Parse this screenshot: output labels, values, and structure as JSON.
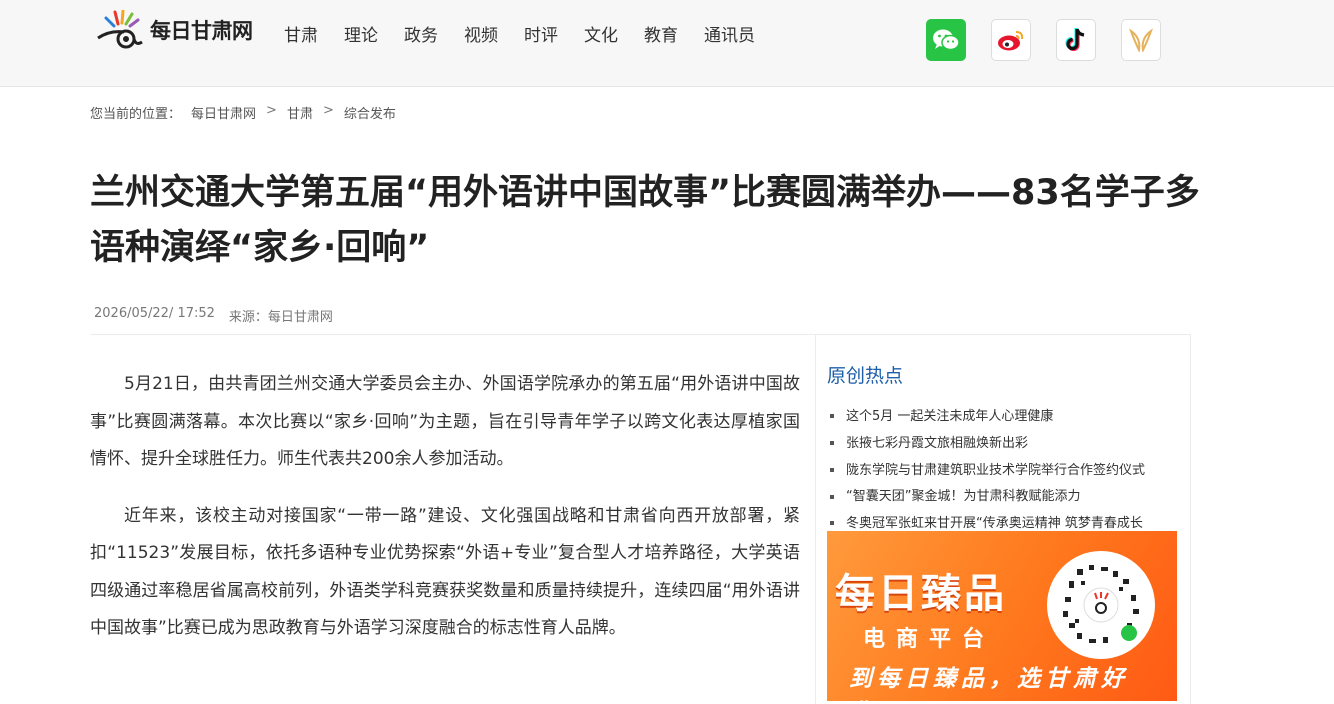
{
  "header": {
    "logo_text": "每日甘肃网",
    "nav": [
      "甘肃",
      "理论",
      "政务",
      "视频",
      "时评",
      "文化",
      "教育",
      "通讯员"
    ],
    "social_icons": [
      "wechat-icon",
      "weibo-icon",
      "tiktok-icon",
      "miniapp-icon"
    ]
  },
  "breadcrumb": {
    "prefix": "您当前的位置：",
    "items": [
      "每日甘肃网",
      "甘肃",
      "综合发布"
    ],
    "separator": ">"
  },
  "article": {
    "title": "兰州交通大学第五届“用外语讲中国故事”比赛圆满举办——83名学子多语种演绎“家乡·回响”",
    "date": "2026/05/22/ 17:52",
    "source": "来源：每日甘肃网",
    "paragraphs": [
      "5月21日，由共青团兰州交通大学委员会主办、外国语学院承办的第五届“用外语讲中国故事”比赛圆满落幕。本次比赛以“家乡·回响”为主题，旨在引导青年学子以跨文化表达厚植家国情怀、提升全球胜任力。师生代表共200余人参加活动。",
      "近年来，该校主动对接国家“一带一路”建设、文化强国战略和甘肃省向西开放部署，紧扣“11523”发展目标，依托多语种专业优势探索“外语+专业”复合型人才培养路径，大学英语四级通过率稳居省属高校前列，外语类学科竞赛获奖数量和质量持续提升，连续四届“用外语讲中国故事”比赛已成为思政教育与外语学习深度融合的标志性育人品牌。"
    ]
  },
  "sidebar": {
    "title": "原创热点",
    "items": [
      "这个5月 一起关注未成年人心理健康",
      "张掖七彩丹霞文旅相融焕新出彩",
      "陇东学院与甘肃建筑职业技术学院举行合作签约仪式",
      "“智囊天团”聚金城！为甘肃科教赋能添力",
      "冬奥冠军张虹来甘开展“传承奥运精神 筑梦青春成长"
    ],
    "ad": {
      "title": "每日臻品",
      "subtitle": "电商平台",
      "slogan": "到每日臻品，选甘肃好货！"
    }
  },
  "colors": {
    "accent_blue": "#1d5fa8",
    "ad_orange": "#ff7a1e",
    "wechat_green": "#28c445"
  }
}
